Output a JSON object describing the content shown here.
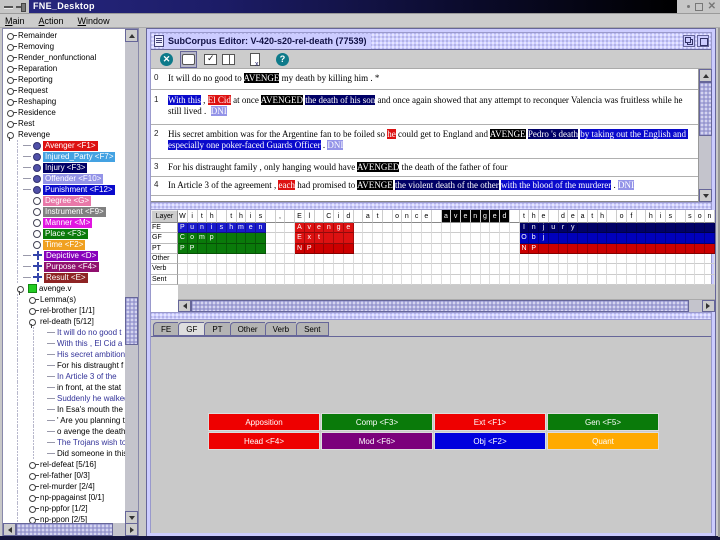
{
  "window": {
    "title": "FNE_Desktop",
    "buttons": {
      "minimize": "minimize",
      "maximize": "maximize",
      "close": "close"
    }
  },
  "menu": {
    "items": [
      {
        "label": "Main"
      },
      {
        "label": "Action"
      },
      {
        "label": "Window"
      }
    ]
  },
  "colors": {
    "target": "#000000",
    "avenger": "#dd1111",
    "injured_party": "#44a2e2",
    "injury": "#000066",
    "offender": "#9494e8",
    "punishment": "#0a0acc",
    "degree": "#e878a8",
    "instrument": "#808080",
    "manner": "#e016e0",
    "place": "#0a7a0a",
    "time": "#f0a020",
    "depictive": "#8800bb",
    "purpose": "#90106e",
    "result": "#8e2424"
  },
  "tree": {
    "frames": [
      {
        "label": "Remainder"
      },
      {
        "label": "Removing"
      },
      {
        "label": "Render_nonfunctional"
      },
      {
        "label": "Reparation"
      },
      {
        "label": "Reporting"
      },
      {
        "label": "Request"
      },
      {
        "label": "Reshaping"
      },
      {
        "label": "Residence"
      },
      {
        "label": "Rest"
      },
      {
        "label": "Revenge",
        "expanded": true
      }
    ],
    "frame_elements": [
      {
        "label": "Avenger <F1>",
        "color": "#dd1111",
        "icon": "core"
      },
      {
        "label": "Injured_Party <F7>",
        "color": "#44a2e2",
        "icon": "core"
      },
      {
        "label": "Injury <F3>",
        "color": "#000066",
        "icon": "core"
      },
      {
        "label": "Offender <F10>",
        "color": "#9494e8",
        "icon": "core"
      },
      {
        "label": "Punishment <F12>",
        "color": "#0a0acc",
        "icon": "core"
      },
      {
        "label": "Degree <G>",
        "color": "#e878a8",
        "icon": "peripheral"
      },
      {
        "label": "Instrument <F9>",
        "color": "#808080",
        "icon": "peripheral"
      },
      {
        "label": "Manner <M>",
        "color": "#e016e0",
        "icon": "peripheral"
      },
      {
        "label": "Place <F3>",
        "color": "#0a7a0a",
        "icon": "peripheral"
      },
      {
        "label": "Time <F2>",
        "color": "#f0a020",
        "icon": "peripheral"
      },
      {
        "label": "Depictive <D>",
        "color": "#8800bb",
        "icon": "extrathematic"
      },
      {
        "label": "Purpose <F4>",
        "color": "#90106e",
        "icon": "extrathematic"
      },
      {
        "label": "Result <E>",
        "color": "#8e2424",
        "icon": "extrathematic"
      }
    ],
    "lexical_unit": {
      "label": "avenge.v"
    },
    "lemma_node": {
      "label": "Lemma(s)"
    },
    "subcorpora_before": [
      {
        "label": "rel-brother [1/1]"
      },
      {
        "label": "rel-death [5/12]",
        "expanded": true
      }
    ],
    "sentences": [
      {
        "text": "It will do no good t",
        "annotated": true
      },
      {
        "text": "With this , El Cid a",
        "annotated": true
      },
      {
        "text": "His secret ambition",
        "annotated": true
      },
      {
        "text": "For his distraught f",
        "annotated": false
      },
      {
        "text": "In Article 3 of the",
        "annotated": true
      },
      {
        "text": "in front, at the stat",
        "annotated": false
      },
      {
        "text": "Suddenly he walked o",
        "annotated": true
      },
      {
        "text": "In Esa's mouth the m",
        "annotated": false
      },
      {
        "text": "' Are you planning t",
        "annotated": false
      },
      {
        "text": "o avenge the death",
        "annotated": false
      },
      {
        "text": "The Trojans wish to",
        "annotated": true
      },
      {
        "text": "Did someone in this",
        "annotated": false
      }
    ],
    "subcorpora_after": [
      {
        "label": "rel-defeat [5/16]"
      },
      {
        "label": "rel-father [0/3]"
      },
      {
        "label": "rel-murder [2/4]"
      },
      {
        "label": "np-ppagainst [0/1]"
      },
      {
        "label": "np-ppfor [1/2]"
      },
      {
        "label": "np-ppon [2/5]"
      }
    ]
  },
  "editor": {
    "frame_title": "SubCorpus Editor: V-420-s20-rel-death (77539)",
    "toolbar": [
      {
        "name": "clear",
        "icon": "teal-x"
      },
      {
        "name": "annotate",
        "icon": "white-rect",
        "selected": true
      },
      {
        "name": "verify",
        "icon": "check-rect"
      },
      {
        "name": "split-view",
        "icon": "split-rect"
      },
      {
        "name": "delete-doc",
        "icon": "doc-x"
      },
      {
        "name": "help",
        "icon": "teal-question"
      }
    ],
    "sentences": [
      {
        "num": "0",
        "tokens": [
          {
            "t": "It will do no good to "
          },
          {
            "t": "AVENGE",
            "c": "target"
          },
          {
            "t": " my death by killing him . *"
          }
        ]
      },
      {
        "num": "1",
        "tokens": [
          {
            "t": "With this",
            "c": "punishment"
          },
          {
            "t": " , "
          },
          {
            "t": "El Cid",
            "c": "avenger"
          },
          {
            "t": " at once "
          },
          {
            "t": "AVENGED",
            "c": "target"
          },
          {
            "t": " "
          },
          {
            "t": "the death of his son",
            "c": "injury"
          },
          {
            "t": " and once again showed that any attempt to reconquer Valencia was fruitless while he still lived .  "
          },
          {
            "t": "DNI",
            "c": "dni"
          }
        ]
      },
      {
        "num": "2",
        "tokens": [
          {
            "t": "His secret ambition was for the Argentine fan to be foiled so "
          },
          {
            "t": "he",
            "c": "avenger"
          },
          {
            "t": " could get to England and "
          },
          {
            "t": "AVENGE",
            "c": "target"
          },
          {
            "t": " "
          },
          {
            "t": "Pedro 's death",
            "c": "injury"
          },
          {
            "t": " "
          },
          {
            "t": "by taking out the English and especially one poker-faced Guards Officer",
            "c": "punishment"
          },
          {
            "t": " . "
          },
          {
            "t": "DNI",
            "c": "dni"
          }
        ]
      },
      {
        "num": "3",
        "tokens": [
          {
            "t": "For his distraught family , only hanging would have "
          },
          {
            "t": "AVENGED",
            "c": "target"
          },
          {
            "t": " the death of the father of four"
          }
        ]
      },
      {
        "num": "4",
        "tokens": [
          {
            "t": "In Article 3 of the agreement , "
          },
          {
            "t": "each",
            "c": "avenger"
          },
          {
            "t": " had promised to "
          },
          {
            "t": "AVENGE",
            "c": "target"
          },
          {
            "t": " "
          },
          {
            "t": "the violent death of the other",
            "c": "injury"
          },
          {
            "t": " "
          },
          {
            "t": "with the blood of the murderer",
            "c": "punishment"
          },
          {
            "t": " . "
          },
          {
            "t": "DNI",
            "c": "dni"
          }
        ]
      }
    ],
    "token_colors": {
      "target": "#000000",
      "avenger": "#dd1111",
      "injury": "#000066",
      "punishment": "#0a0acc",
      "dni": "#9494e8"
    }
  },
  "grid": {
    "corner_label": "Layer",
    "row_labels": [
      "FE",
      "GF",
      "PT",
      "Other",
      "Verb",
      "Sent"
    ],
    "sentence_chars": "With this , El Cid at once avenged the death of his son",
    "target_range": [
      27,
      33
    ],
    "spans": {
      "FE": [
        {
          "start": 0,
          "len": 9,
          "label": "Punishment",
          "color": "#1a1acc"
        },
        {
          "start": 12,
          "len": 6,
          "label": "Avenger",
          "color": "#dd1111"
        },
        {
          "start": 35,
          "len": 20,
          "label": "Injury",
          "color": "#000066"
        }
      ],
      "GF": [
        {
          "start": 0,
          "len": 9,
          "label": "Comp",
          "color": "#0a7a0a"
        },
        {
          "start": 12,
          "len": 6,
          "label": "Ext",
          "color": "#dd1111"
        },
        {
          "start": 35,
          "len": 20,
          "label": "Obj",
          "color": "#0000bb"
        }
      ],
      "PT": [
        {
          "start": 0,
          "len": 9,
          "label": "PP",
          "color": "#0a7a0a"
        },
        {
          "start": 12,
          "len": 6,
          "label": "NP",
          "color": "#cc0000"
        },
        {
          "start": 35,
          "len": 20,
          "label": "NP",
          "color": "#cc0000"
        }
      ]
    }
  },
  "tabs": {
    "items": [
      "FE",
      "GF",
      "PT",
      "Other",
      "Verb",
      "Sent"
    ],
    "selected": "GF"
  },
  "gf_buttons": [
    [
      {
        "label": "Apposition",
        "color": "#ee0000"
      },
      {
        "label": "Comp <F3>",
        "color": "#0a7a0a"
      },
      {
        "label": "Ext <F1>",
        "color": "#ee0000"
      },
      {
        "label": "Gen <F5>",
        "color": "#0a7a0a"
      }
    ],
    [
      {
        "label": "Head <F4>",
        "color": "#ee0000"
      },
      {
        "label": "Mod <F6>",
        "color": "#7b007b"
      },
      {
        "label": "Obj <F2>",
        "color": "#0000dd"
      },
      {
        "label": "Quant",
        "color": "#ffaa00"
      }
    ]
  ]
}
